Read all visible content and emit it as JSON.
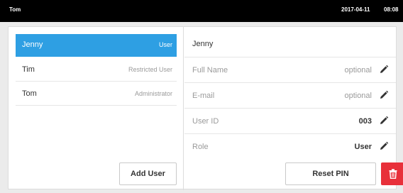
{
  "topbar": {
    "current_user": "Tom",
    "date": "2017-04-11",
    "time": "08:08"
  },
  "users": [
    {
      "name": "Jenny",
      "role": "User",
      "selected": true
    },
    {
      "name": "Tim",
      "role": "Restricted User",
      "selected": false
    },
    {
      "name": "Tom",
      "role": "Administrator",
      "selected": false
    }
  ],
  "left_panel": {
    "add_user_label": "Add User"
  },
  "detail": {
    "heading": "Jenny",
    "fields": [
      {
        "label": "Full Name",
        "value": "optional",
        "emphasis": false
      },
      {
        "label": "E-mail",
        "value": "optional",
        "emphasis": false
      },
      {
        "label": "User ID",
        "value": "003",
        "emphasis": true
      },
      {
        "label": "Role",
        "value": "User",
        "emphasis": true
      }
    ],
    "reset_pin_label": "Reset PIN"
  },
  "colors": {
    "accent": "#2e9fe3",
    "danger": "#e8303a",
    "topbar": "#000000"
  },
  "icons": {
    "edit": "pencil-icon",
    "delete": "trash-icon"
  }
}
